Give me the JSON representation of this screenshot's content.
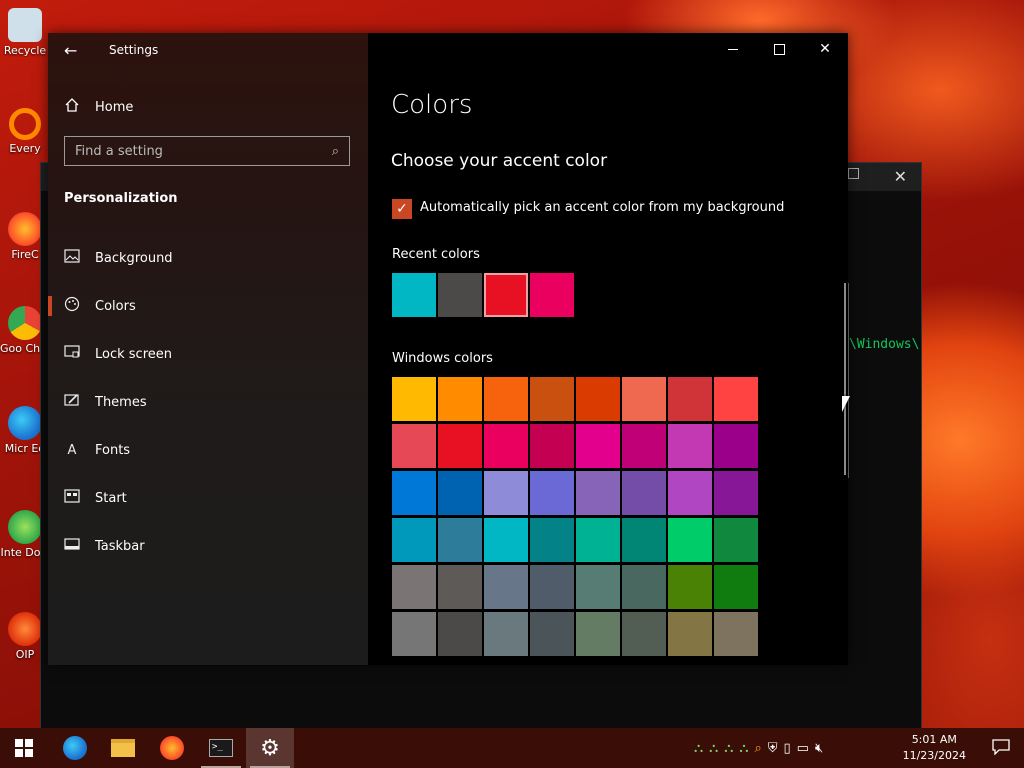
{
  "desktop": {
    "icons": [
      {
        "label": "Recycle",
        "color": "#bcd6e6"
      },
      {
        "label": "Every",
        "color": "#ff8a00"
      },
      {
        "label": "FireC",
        "color": "#ff5a28"
      },
      {
        "label": "Goo Chro",
        "color": "#34a853"
      },
      {
        "label": "Micr Ed",
        "color": "#1e7ad6"
      },
      {
        "label": "Inte Dow",
        "color": "#2fa84a"
      },
      {
        "label": "OIP",
        "color": "#ff4a1a"
      }
    ]
  },
  "terminal": {
    "visible_text": "\\Windows\\"
  },
  "settings": {
    "app_title": "Settings",
    "nav": {
      "home_label": "Home",
      "search_placeholder": "Find a setting",
      "section_heading": "Personalization",
      "items": [
        {
          "label": "Background",
          "icon": "image-icon"
        },
        {
          "label": "Colors",
          "icon": "palette-icon"
        },
        {
          "label": "Lock screen",
          "icon": "lock-screen-icon"
        },
        {
          "label": "Themes",
          "icon": "brush-icon"
        },
        {
          "label": "Fonts",
          "icon": "font-icon"
        },
        {
          "label": "Start",
          "icon": "start-icon"
        },
        {
          "label": "Taskbar",
          "icon": "taskbar-icon"
        }
      ]
    },
    "content": {
      "page_title": "Colors",
      "subtitle": "Choose your accent color",
      "auto_pick_label": "Automatically pick an accent color from my background",
      "recent_label": "Recent colors",
      "recent_colors": [
        "#00b7c3",
        "#4c4a48",
        "#e81123",
        "#ea005e"
      ],
      "windows_label": "Windows colors",
      "windows_colors": [
        "#ffb900",
        "#ff8c00",
        "#f7630c",
        "#ca5010",
        "#da3b01",
        "#ef6950",
        "#d13438",
        "#ff4343",
        "#e74856",
        "#e81123",
        "#ea005e",
        "#c30052",
        "#e3008c",
        "#bf0077",
        "#c239b3",
        "#9a0089",
        "#0078d7",
        "#0063b1",
        "#8e8cd8",
        "#6b69d6",
        "#8764b8",
        "#744da9",
        "#b146c2",
        "#881798",
        "#0099bc",
        "#2d7d9a",
        "#00b7c3",
        "#038387",
        "#00b294",
        "#018574",
        "#00cc6a",
        "#10893e",
        "#7a7574",
        "#5d5a58",
        "#68768a",
        "#515c6b",
        "#567c73",
        "#486860",
        "#498205",
        "#107c10",
        "#767676",
        "#4c4a48",
        "#69797e",
        "#4a5459",
        "#647c64",
        "#525e54",
        "#847545",
        "#7e735f"
      ]
    }
  },
  "taskbar": {
    "clock_time": "5:01 AM",
    "clock_date": "11/23/2024"
  },
  "colors": {
    "accent": "#c94722"
  }
}
